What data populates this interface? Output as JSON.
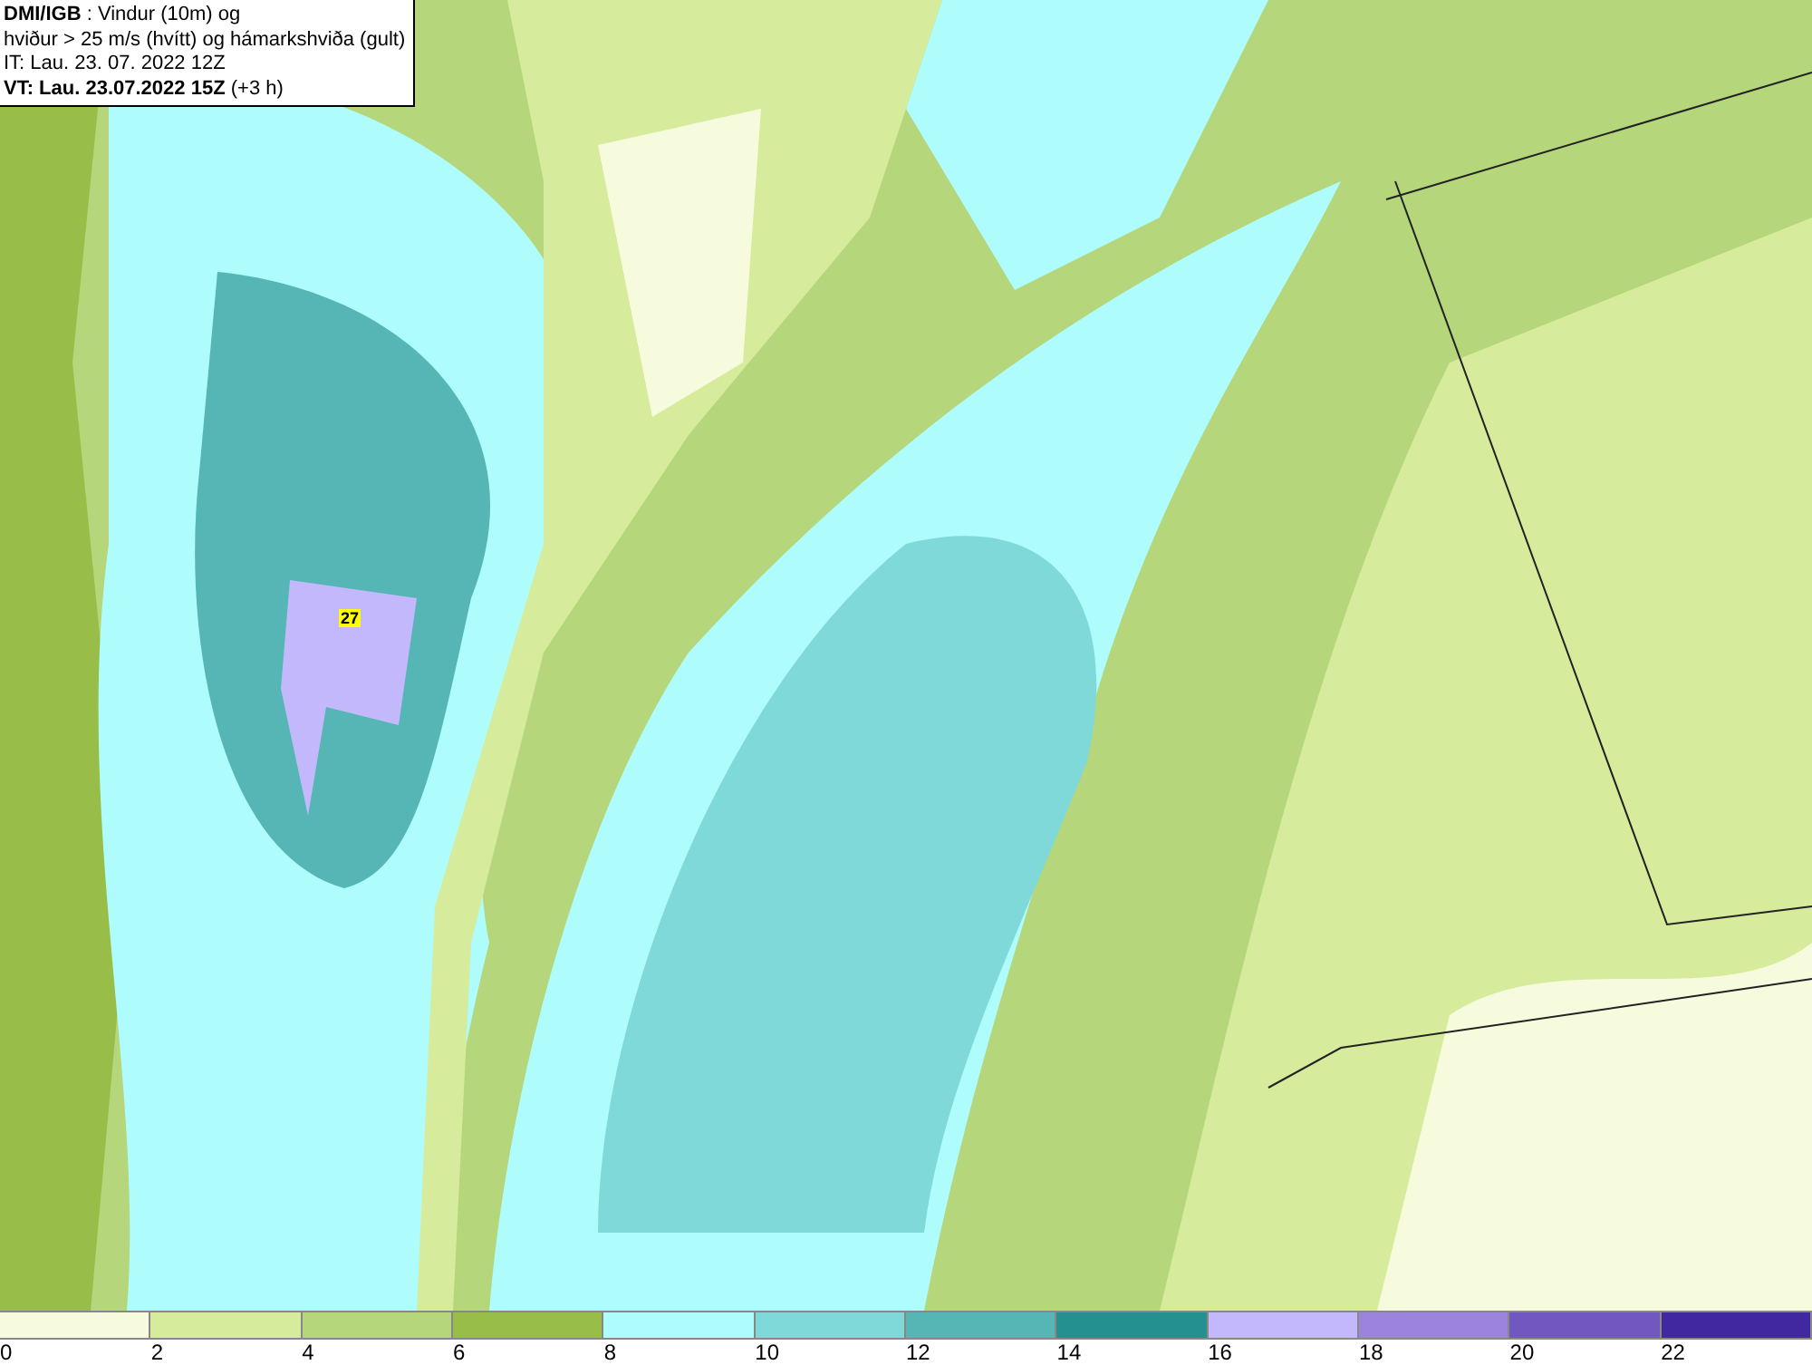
{
  "map": {
    "title_lines": [
      "**DMI/IGB** : Vindur (10m) og",
      "hviður > 25 m/s (hvítt) og hámarkshviða (gult)",
      "IT: Lau. 23. 07. 2022 12Z",
      "**VT: Lau. 23.07.2022 15Z** (+3 h)"
    ],
    "max_gust": "27"
  },
  "legend": [
    {
      "label": "0",
      "color": "#f5fbdc"
    },
    {
      "label": "2",
      "color": "#d6ec9c"
    },
    {
      "label": "4",
      "color": "#b5d67a"
    },
    {
      "label": "6",
      "color": "#98bd48"
    },
    {
      "label": "8",
      "color": "#aefcfc"
    },
    {
      "label": "10",
      "color": "#7fd9d9"
    },
    {
      "label": "12",
      "color": "#56b6b6"
    },
    {
      "label": "14",
      "color": "#259090"
    },
    {
      "label": "16",
      "color": "#c4b8fc"
    },
    {
      "label": "18",
      "color": "#9a84dc"
    },
    {
      "label": "20",
      "color": "#7058c0"
    },
    {
      "label": "22",
      "color": "#4228a0"
    }
  ]
}
